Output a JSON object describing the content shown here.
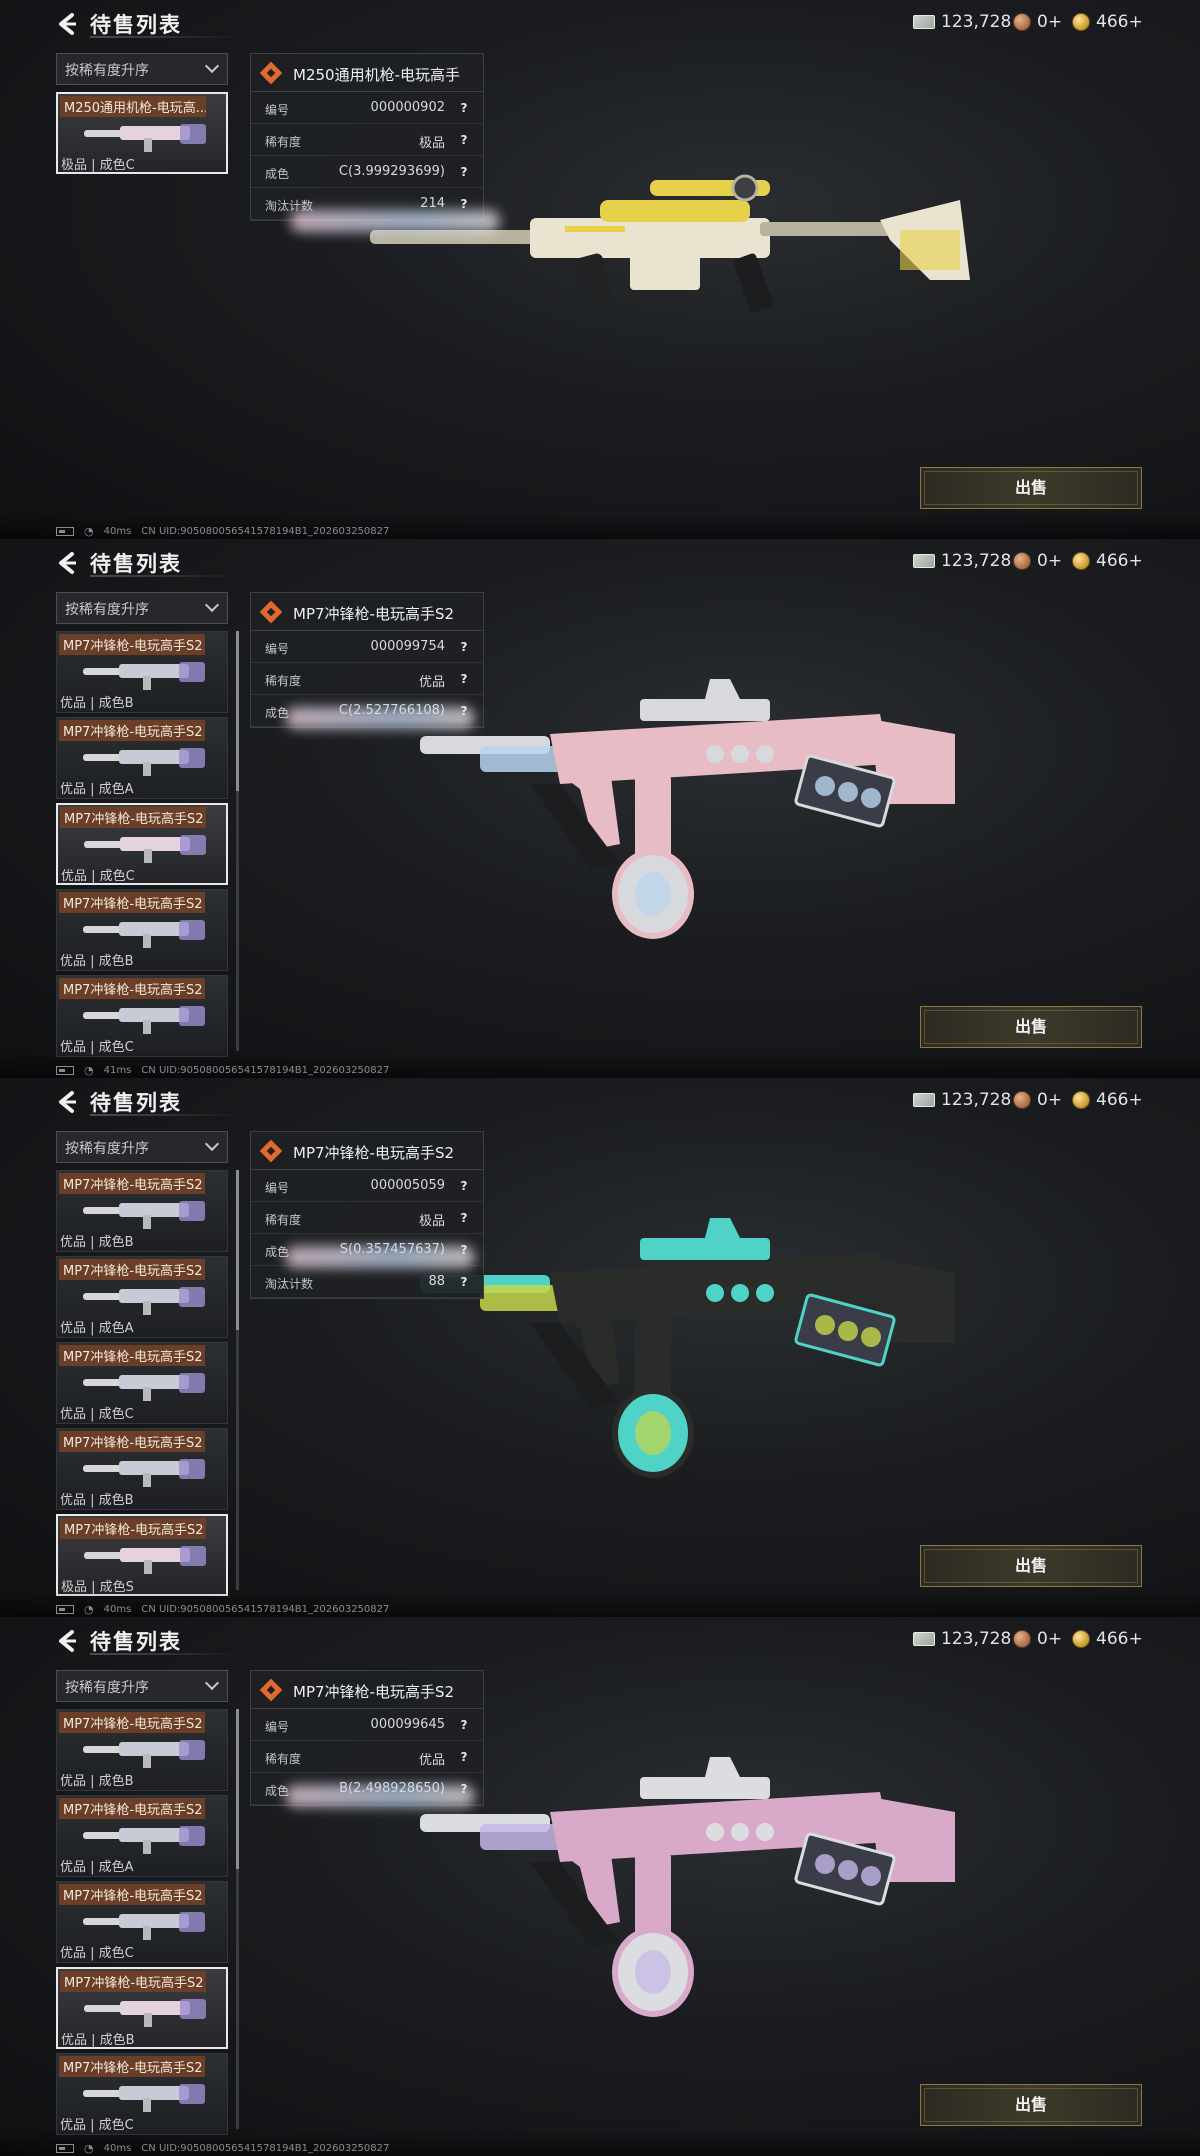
{
  "title": "待售列表",
  "currency": {
    "cash": "123,728",
    "bronze": "0+",
    "gold": "466+"
  },
  "sort_label": "按稀有度升序",
  "sell_label": "出售",
  "status_uid": "CN UID:905080056541578194B1_202603250827",
  "panels": [
    {
      "latency": "40ms",
      "list": [
        {
          "name": "M250通用机枪-电玩高...",
          "sub": "极品 | 成色C",
          "selected": true
        }
      ],
      "detail": {
        "name": "M250通用机枪-电玩高手",
        "rows": [
          {
            "label": "编号",
            "value": "000000902"
          },
          {
            "label": "稀有度",
            "value": "极品"
          },
          {
            "label": "成色",
            "value": "C(3.999293699)"
          },
          {
            "label": "淘汰计数",
            "value": "214"
          }
        ]
      },
      "gun_colors": {
        "body": "#e9e3cf",
        "accent": "#e8d14a",
        "trim": "#b7b39f"
      }
    },
    {
      "latency": "41ms",
      "list": [
        {
          "name": "MP7冲锋枪-电玩高手S2",
          "sub": "优品 | 成色B",
          "selected": false
        },
        {
          "name": "MP7冲锋枪-电玩高手S2",
          "sub": "优品 | 成色A",
          "selected": false
        },
        {
          "name": "MP7冲锋枪-电玩高手S2",
          "sub": "优品 | 成色C",
          "selected": true
        },
        {
          "name": "MP7冲锋枪-电玩高手S2",
          "sub": "优品 | 成色B",
          "selected": false
        },
        {
          "name": "MP7冲锋枪-电玩高手S2",
          "sub": "优品 | 成色C",
          "selected": false
        }
      ],
      "detail": {
        "name": "MP7冲锋枪-电玩高手S2",
        "rows": [
          {
            "label": "编号",
            "value": "000099754"
          },
          {
            "label": "稀有度",
            "value": "优品"
          },
          {
            "label": "成色",
            "value": "C(2.527766108)"
          }
        ]
      },
      "gun_colors": {
        "body": "#e8bcc4",
        "accent": "#b9d4f0",
        "trim": "#d8d9dc"
      }
    },
    {
      "latency": "40ms",
      "list": [
        {
          "name": "MP7冲锋枪-电玩高手S2",
          "sub": "优品 | 成色B",
          "selected": false
        },
        {
          "name": "MP7冲锋枪-电玩高手S2",
          "sub": "优品 | 成色A",
          "selected": false
        },
        {
          "name": "MP7冲锋枪-电玩高手S2",
          "sub": "优品 | 成色C",
          "selected": false
        },
        {
          "name": "MP7冲锋枪-电玩高手S2",
          "sub": "优品 | 成色B",
          "selected": false
        },
        {
          "name": "MP7冲锋枪-电玩高手S2",
          "sub": "极品 | 成色S",
          "selected": true
        }
      ],
      "detail": {
        "name": "MP7冲锋枪-电玩高手S2",
        "rows": [
          {
            "label": "编号",
            "value": "000005059"
          },
          {
            "label": "稀有度",
            "value": "极品"
          },
          {
            "label": "成色",
            "value": "S(0.357457637)"
          },
          {
            "label": "淘汰计数",
            "value": "88"
          }
        ]
      },
      "gun_colors": {
        "body": "#2a2c2a",
        "accent": "#c7d64a",
        "trim": "#4fd3c6"
      }
    },
    {
      "latency": "40ms",
      "list": [
        {
          "name": "MP7冲锋枪-电玩高手S2",
          "sub": "优品 | 成色B",
          "selected": false
        },
        {
          "name": "MP7冲锋枪-电玩高手S2",
          "sub": "优品 | 成色A",
          "selected": false
        },
        {
          "name": "MP7冲锋枪-电玩高手S2",
          "sub": "优品 | 成色C",
          "selected": false
        },
        {
          "name": "MP7冲锋枪-电玩高手S2",
          "sub": "优品 | 成色B",
          "selected": true
        },
        {
          "name": "MP7冲锋枪-电玩高手S2",
          "sub": "优品 | 成色C",
          "selected": false
        }
      ],
      "detail": {
        "name": "MP7冲锋枪-电玩高手S2",
        "rows": [
          {
            "label": "编号",
            "value": "000099645"
          },
          {
            "label": "稀有度",
            "value": "优品"
          },
          {
            "label": "成色",
            "value": "B(2.498928650)"
          }
        ]
      },
      "gun_colors": {
        "body": "#d9a9c9",
        "accent": "#c4b7e8",
        "trim": "#dcdde0"
      }
    }
  ]
}
